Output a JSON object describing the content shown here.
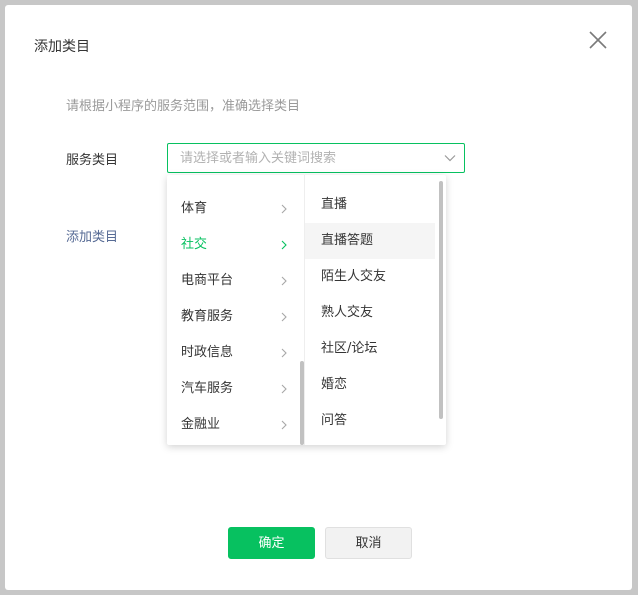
{
  "dialog": {
    "title": "添加类目",
    "hint": "请根据小程序的服务范围，准确选择类目",
    "field_label": "服务类目",
    "select_placeholder": "请选择或者输入关键词搜索",
    "add_link": "添加类目",
    "confirm_label": "确定",
    "cancel_label": "取消"
  },
  "cascader": {
    "level1": [
      {
        "label": "体育",
        "active": false
      },
      {
        "label": "社交",
        "active": true
      },
      {
        "label": "电商平台",
        "active": false
      },
      {
        "label": "教育服务",
        "active": false
      },
      {
        "label": "时政信息",
        "active": false
      },
      {
        "label": "汽车服务",
        "active": false
      },
      {
        "label": "金融业",
        "active": false
      }
    ],
    "level2": [
      {
        "label": "直播"
      },
      {
        "label": "直播答题",
        "hover": true
      },
      {
        "label": "陌生人交友"
      },
      {
        "label": "熟人交友"
      },
      {
        "label": "社区/论坛"
      },
      {
        "label": "婚恋"
      },
      {
        "label": "问答"
      }
    ]
  },
  "colors": {
    "accent": "#07c160",
    "link": "#576b95",
    "text": "#353535",
    "muted": "#9a9a9a"
  },
  "icons": {
    "close": "close-icon",
    "dropdown": "chevron-down-icon",
    "submenu": "chevron-right-icon"
  }
}
